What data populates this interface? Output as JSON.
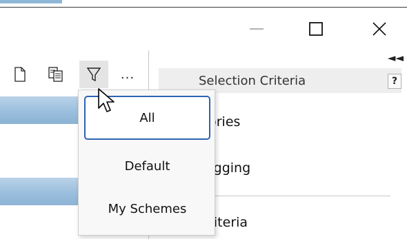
{
  "window": {
    "minimize_icon": "minimize-icon",
    "maximize_icon": "maximize-icon",
    "close_icon": "close-icon"
  },
  "toolbar": {
    "icons": [
      "new-document-icon",
      "copy-icon",
      "filter-icon"
    ],
    "more_label": "..."
  },
  "filter_menu": {
    "items": [
      {
        "label": "All",
        "selected": true
      },
      {
        "label": "Default",
        "selected": false
      },
      {
        "label": "My Schemes",
        "selected": false
      }
    ]
  },
  "selection_panel": {
    "collapse_label": "◄◄",
    "title": "Selection Criteria",
    "help_label": "?",
    "items": [
      {
        "label": "Categories"
      },
      {
        "label": "Part Tagging"
      },
      {
        "label": "Add Criteria"
      }
    ]
  },
  "colors": {
    "accent": "#2b63b4",
    "row_highlight": "#9bbfdd",
    "header_bg": "#eeeeee"
  }
}
